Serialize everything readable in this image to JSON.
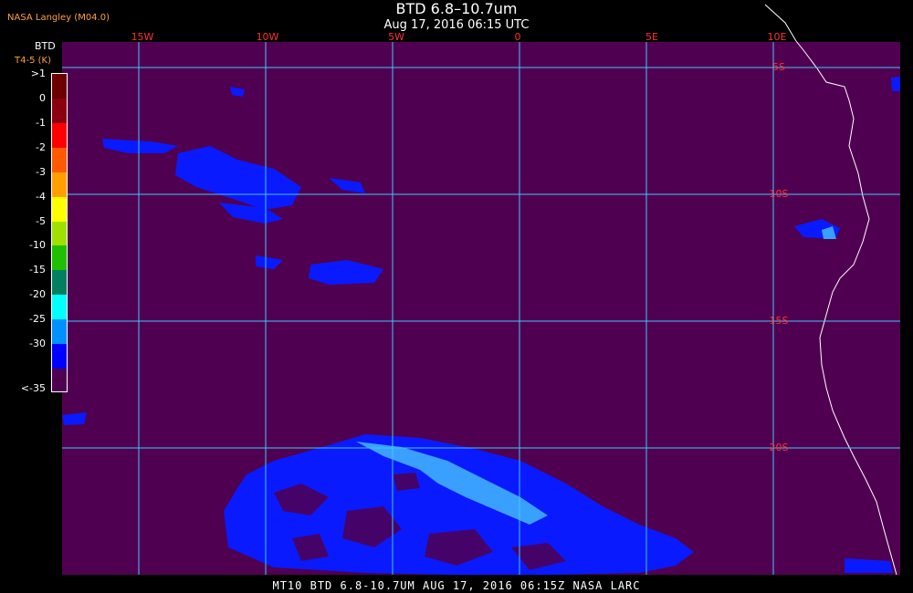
{
  "header": {
    "agency": "NASA Langley (M04.0)",
    "title": "BTD 6.8–10.7um",
    "subtitle": "Aug 17, 2016 06:15 UTC"
  },
  "legend": {
    "title": "BTD",
    "unit": "T4-5 (K)",
    "levels": [
      {
        "label": ">1",
        "color": "#6b0000"
      },
      {
        "label": "0",
        "color": "#8a0010"
      },
      {
        "label": "-1",
        "color": "#ff0000"
      },
      {
        "label": "-2",
        "color": "#ff5a00"
      },
      {
        "label": "-3",
        "color": "#ffa000"
      },
      {
        "label": "-4",
        "color": "#ffff00"
      },
      {
        "label": "-5",
        "color": "#a0e000"
      },
      {
        "label": "-10",
        "color": "#20c000"
      },
      {
        "label": "-15",
        "color": "#008060"
      },
      {
        "label": "-20",
        "color": "#00ffff"
      },
      {
        "label": "-25",
        "color": "#0090ff"
      },
      {
        "label": "-30",
        "color": "#0000ff"
      },
      {
        "label": "<-35",
        "color": "#500050"
      }
    ]
  },
  "map": {
    "background": "#500050",
    "grid_color": "#40c8ff",
    "label_color": "#ff3030",
    "lon_labels": [
      "15W",
      "10W",
      "5W",
      "0",
      "5E",
      "10E"
    ],
    "lat_labels": [
      "5S",
      "10S",
      "15S",
      "20S"
    ]
  },
  "footer": {
    "text": "MT10  BTD 6.8-10.7UM   AUG 17, 2016 06:15Z   NASA LARC"
  }
}
